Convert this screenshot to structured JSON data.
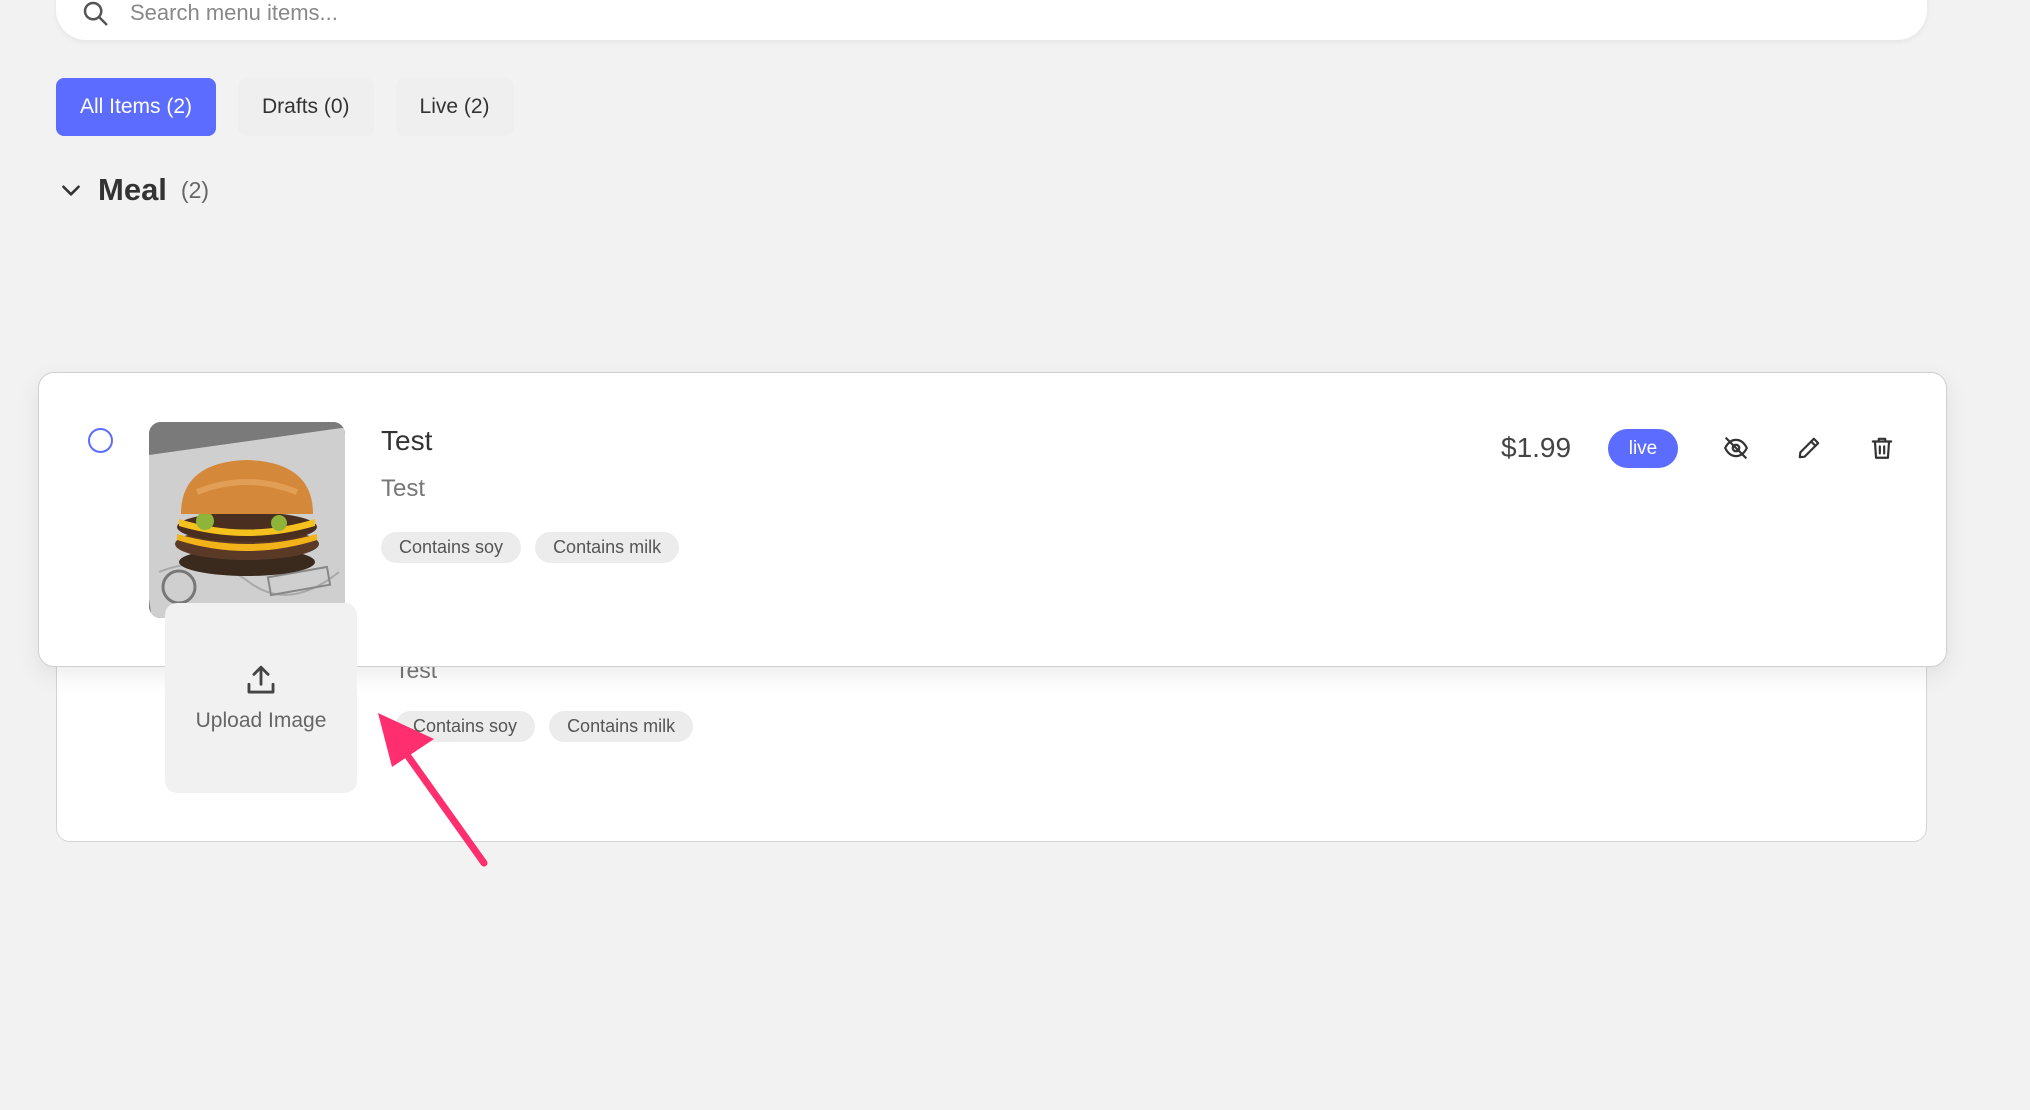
{
  "search": {
    "placeholder": "Search menu items..."
  },
  "tabs": [
    {
      "label": "All Items (2)",
      "active": true
    },
    {
      "label": "Drafts (0)",
      "active": false
    },
    {
      "label": "Live (2)",
      "active": false
    }
  ],
  "category": {
    "title": "Meal",
    "count": "(2)"
  },
  "dragged_item": {
    "name": "Test",
    "description": "Test",
    "tags": [
      "Contains soy",
      "Contains milk"
    ],
    "price": "$1.99",
    "status": "live",
    "image": "burger-photo"
  },
  "underlying_item": {
    "description": "Test",
    "tags": [
      "Contains soy",
      "Contains milk"
    ]
  },
  "upload": {
    "label": "Upload Image"
  },
  "colors": {
    "accent": "#5b6cff",
    "background": "#f2f2f2",
    "arrow": "#ff2e6e"
  },
  "icons": [
    "search-icon",
    "chevron-down-icon",
    "eye-off-icon",
    "pencil-icon",
    "trash-icon",
    "upload-icon",
    "annotation-arrow"
  ]
}
